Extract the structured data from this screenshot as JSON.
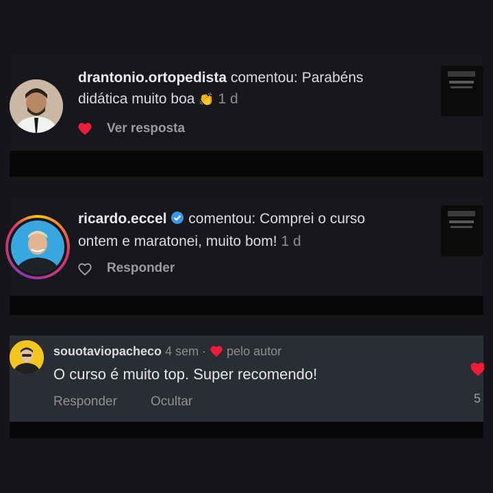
{
  "comments": [
    {
      "username": "drantonio.ortopedista",
      "text_line1": " comentou: Parabéns",
      "text_line2": "didática muito boa ",
      "time": "1 d",
      "action": "Ver resposta",
      "emoji": "👏"
    },
    {
      "username": "ricardo.eccel",
      "verified": true,
      "text_line1": " comentou: Comprei o curso",
      "text_line2": "ontem e maratonei, muito bom! ",
      "time": "1 d",
      "action": "Responder"
    }
  ],
  "reply": {
    "username": "souotaviopacheco",
    "time": "4 sem",
    "separator": "·",
    "liked_by": "pelo autor",
    "text": "O curso é muito top. Super recomendo!",
    "reply_label": "Responder",
    "hide_label": "Ocultar",
    "like_count": "5"
  },
  "colors": {
    "background": "#15151a",
    "card": "#17181c",
    "reply_card": "#2a2d33",
    "heart": "#ee1c3a",
    "verified": "#3897f0"
  }
}
